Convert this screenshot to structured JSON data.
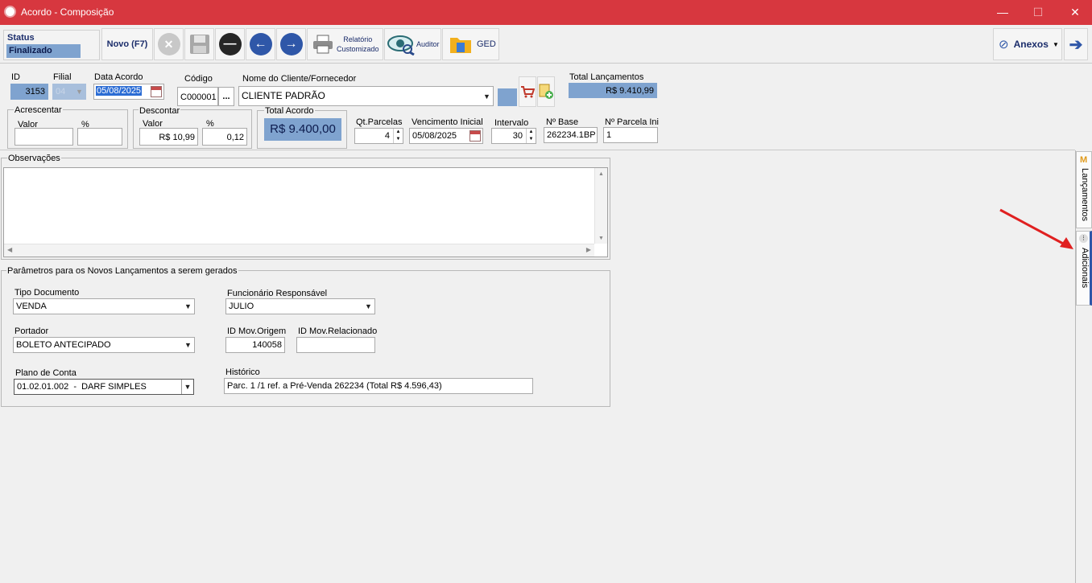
{
  "window": {
    "title": "Acordo - Composição",
    "minimize": "—",
    "maximize": "☐",
    "close": "✕"
  },
  "toolbar": {
    "status_label": "Status",
    "status_value": "Finalizado",
    "novo_label": "Novo (F7)",
    "relatorio_line1": "Relatório",
    "relatorio_line2": "Customizado",
    "auditor_label": "Auditor",
    "ged_label": "GED",
    "anexos_label": "Anexos"
  },
  "header": {
    "id_label": "ID",
    "id_value": "3153",
    "filial_label": "Filial",
    "filial_value": "04",
    "data_acordo_label": "Data Acordo",
    "data_acordo_value": "05/08/2025",
    "codigo_label": "Código",
    "codigo_value": "C000001",
    "codigo_btn": "...",
    "cliente_label": "Nome do Cliente/Fornecedor",
    "cliente_value": "CLIENTE PADRÃO",
    "total_lanc_label": "Total Lançamentos",
    "total_lanc_value": "R$ 9.410,99"
  },
  "acrescentar": {
    "title": "Acrescentar",
    "valor_label": "Valor",
    "pct_label": "%",
    "valor_value": "",
    "pct_value": ""
  },
  "descontar": {
    "title": "Descontar",
    "valor_label": "Valor",
    "pct_label": "%",
    "valor_value": "R$ 10,99",
    "pct_value": "0,12"
  },
  "total_acordo": {
    "title": "Total Acordo",
    "value": "R$ 9.400,00"
  },
  "parcelas": {
    "qt_label": "Qt.Parcelas",
    "qt_value": "4",
    "venc_label": "Vencimento Inicial",
    "venc_value": "05/08/2025",
    "intervalo_label": "Intervalo",
    "intervalo_value": "30",
    "nbase_label": "Nº Base",
    "nbase_value": "262234.1BP",
    "nparcela_label": "Nº Parcela Ini",
    "nparcela_value": "1"
  },
  "observacoes": {
    "title": "Observações",
    "value": ""
  },
  "parametros": {
    "title": "Parâmetros para os Novos Lançamentos a serem gerados",
    "tipo_doc_label": "Tipo Documento",
    "tipo_doc_value": "VENDA",
    "funcionario_label": "Funcionário Responsável",
    "funcionario_value": "JULIO",
    "portador_label": "Portador",
    "portador_value": "BOLETO ANTECIPADO",
    "id_mov_origem_label": "ID Mov.Origem",
    "id_mov_origem_value": "140058",
    "id_mov_rel_label": "ID Mov.Relacionado",
    "id_mov_rel_value": "",
    "plano_label": "Plano de Conta",
    "plano_value": "01.02.01.002  -  DARF SIMPLES",
    "historico_label": "Histórico",
    "historico_value": "Parc. 1 /1  ref. a Pré-Venda 262234 (Total R$ 4.596,43)"
  },
  "side_tabs": [
    {
      "label": "Lançamentos"
    },
    {
      "label": "Adicionais"
    }
  ],
  "colors": {
    "titlebar": "#d7373f",
    "field_blue": "#7fa3cf",
    "arrow": "#e02020"
  }
}
